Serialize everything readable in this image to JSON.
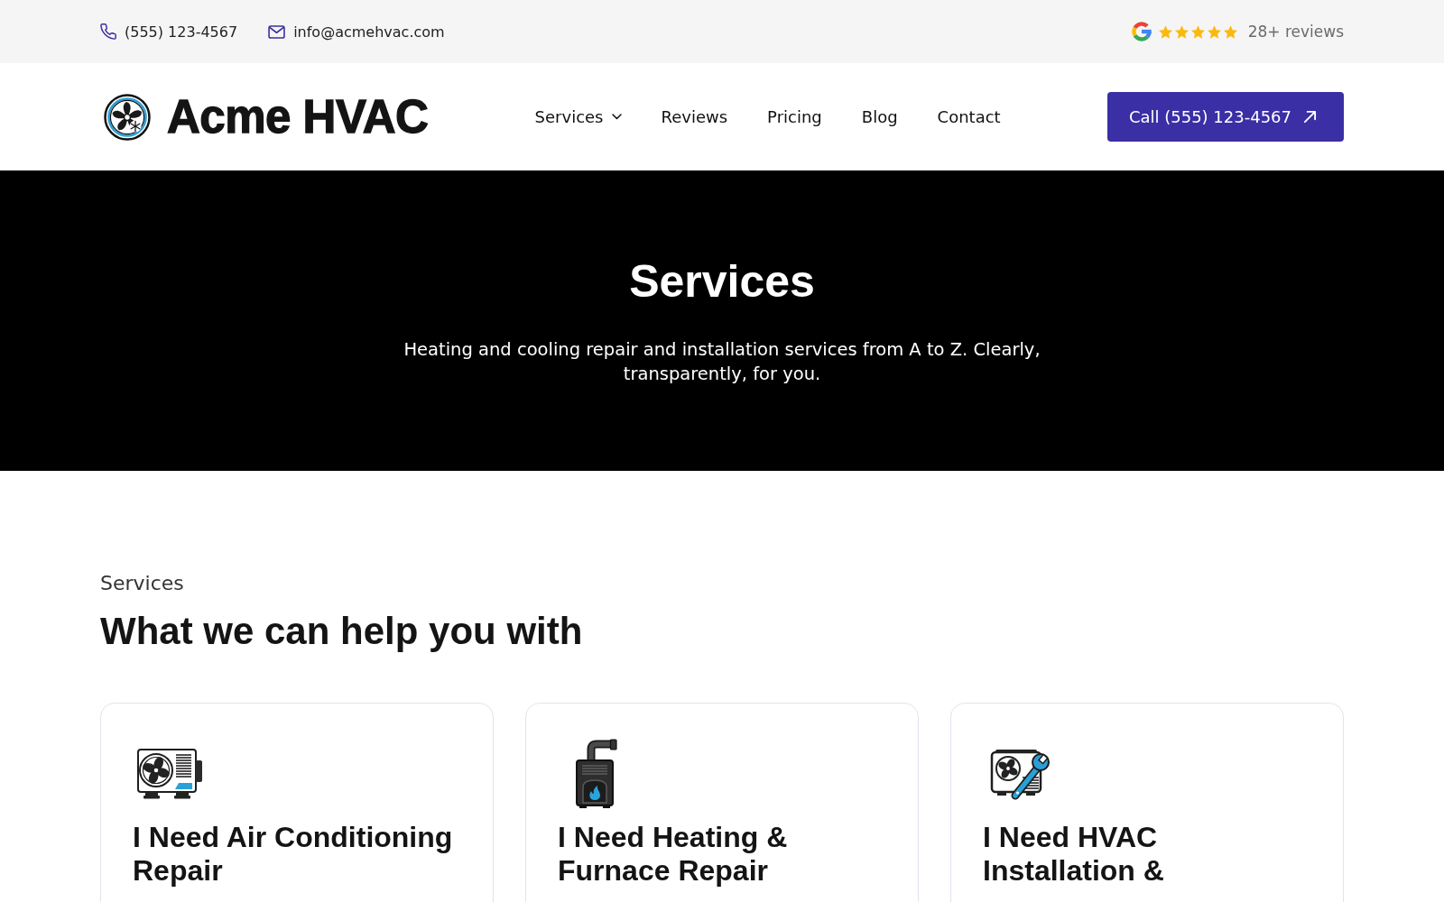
{
  "top_bar": {
    "phone": "(555) 123-4567",
    "email": "info@acmehvac.com",
    "rating": {
      "stars": 5,
      "reviews": "28+ reviews"
    }
  },
  "header": {
    "brand": "Acme HVAC",
    "nav": [
      {
        "label": "Services",
        "dropdown": true
      },
      {
        "label": "Reviews",
        "dropdown": false
      },
      {
        "label": "Pricing",
        "dropdown": false
      },
      {
        "label": "Blog",
        "dropdown": false
      },
      {
        "label": "Contact",
        "dropdown": false
      }
    ],
    "call_button": "Call (555) 123-4567"
  },
  "hero": {
    "title": "Services",
    "subtitle": "Heating and cooling repair and installation services from A to Z. Clearly, transparently, for you."
  },
  "services": {
    "eyebrow": "Services",
    "heading": "What we can help you with",
    "cards": [
      {
        "kind": "ac_repair",
        "title": "I Need Air Conditioning Repair"
      },
      {
        "kind": "furnace_repair",
        "title": "I Need Heating & Furnace Repair"
      },
      {
        "kind": "installation",
        "title": "I Need HVAC Installation &"
      }
    ]
  }
}
